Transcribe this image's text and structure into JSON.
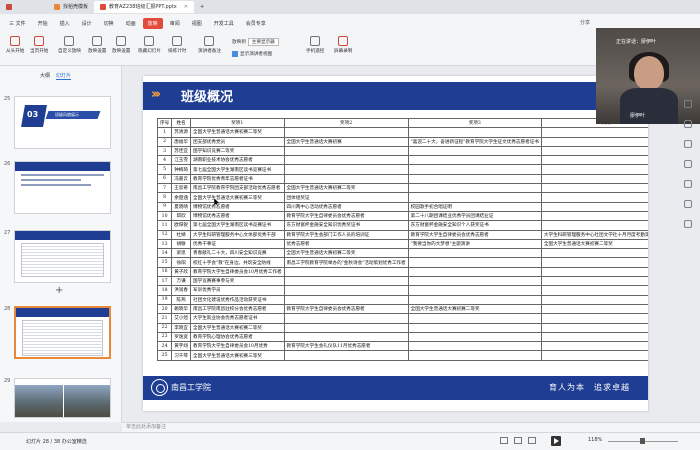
{
  "tabs": [
    {
      "label": "",
      "active": false
    },
    {
      "label": "找稻壳模板",
      "active": false
    },
    {
      "label": "教育AZ238班级汇报PPT.pptx",
      "active": true
    }
  ],
  "menu": [
    "三 文件",
    "开始",
    "插入",
    "设计",
    "切换",
    "动画",
    "放映",
    "审阅",
    "视图",
    "开发工具",
    "会员专享"
  ],
  "menu_active_index": 6,
  "share_label": "分享",
  "ribbon": {
    "buttons": [
      "从头开始",
      "当页开始",
      "自定义放映",
      "放映设置",
      "放映设置",
      "隐藏幻灯片",
      "排练计时",
      "演讲者备注",
      "手机遥控",
      "屏幕录制"
    ],
    "monitor_label": "放映到",
    "monitor_value": "主要显示器",
    "show_toolbar_label": "显示演讲者视图"
  },
  "left_panel": {
    "tabs": [
      "大纲",
      "幻灯片"
    ],
    "thumb_numbers": [
      "25",
      "26",
      "27",
      "28",
      "29"
    ],
    "section_thumb_text": "班级风貌展示",
    "section_thumb_number": "03"
  },
  "slide": {
    "title": "班级概况",
    "table_headers": [
      "序号",
      "姓名",
      "奖项1",
      "奖项2",
      "奖项3",
      "奖项4",
      "奖项5"
    ],
    "rows": [
      [
        "1",
        "苏清源",
        "全国大学生普通话大赛初赛二等奖",
        "",
        "",
        "",
        ""
      ],
      [
        "2",
        "唐福华",
        "团支部优秀党员",
        "全国大学生普通话大赛初赛",
        "\"喜迎二十大，奋进新征程\"教育学院大学生征文优秀志愿者证书",
        "",
        ""
      ],
      [
        "3",
        "苏佳宜",
        "国学知识竞赛二等奖",
        "",
        "",
        "",
        ""
      ],
      [
        "4",
        "江玉雪",
        "湖南职业技术协会优秀志愿者",
        "",
        "",
        "",
        ""
      ],
      [
        "5",
        "钟梅琦",
        "第七届全国大学生湖南区读书竞赛证书",
        "",
        "",
        "",
        ""
      ],
      [
        "6",
        "冯嘉云",
        "教育学院优秀青年志愿者证书",
        "",
        "",
        "",
        ""
      ],
      [
        "7",
        "王思奇",
        "南昌工学院教育学院团支部活动优秀志愿者",
        "全国大学生普通话大赛初赛二等奖",
        "",
        "",
        ""
      ],
      [
        "8",
        "余楚涵",
        "全国大学生普通话大赛初赛三等奖",
        "团体组奖证",
        "",
        "",
        ""
      ],
      [
        "9",
        "夏晓晴",
        "博物馆优秀志愿者",
        "四川两中心活动优秀志愿者",
        "校园歌手初合唱证明",
        "",
        ""
      ],
      [
        "10",
        "邱欣",
        "博物馆优秀志愿者",
        "教育学院大学生自律委员会优秀志愿者",
        "第二十八期团课结业优秀学员团课结业证",
        "",
        ""
      ],
      [
        "11",
        "欧阳锐",
        "第七届全国大学生湖南区读书竞赛证书",
        "东方财富杯金融安全知识优秀奖证书",
        "东方财富杯金融安全知识个人获奖证书",
        "",
        ""
      ],
      [
        "12",
        "杜婧",
        "大学生科研管理服务中心文体部优秀干部",
        "教育学院大学生会部门工作人员的培训证",
        "教育学院大学生自律委员会优秀志愿者",
        "大学生科研管理服务中心社团文学社十月月度考勤第一获得证书",
        ""
      ],
      [
        "13",
        "胡敏",
        "优秀干事证",
        "优秀志愿者",
        "\"我要当你的大梦想\"主题演讲",
        "全国大学生普通话大赛初赛二等奖",
        "军训优秀学员"
      ],
      [
        "14",
        "梁思",
        "青春献礼二十大，四川安全知识竞赛",
        "全国大学生普通话大赛初赛二等奖",
        "",
        "",
        ""
      ],
      [
        "15",
        "徐阳",
        "校红十字会\"救\"在身边，共筑安全防线",
        "南昌工学院教育学院举办的\"金秋诗会\"活动策划优秀工作者",
        "",
        "",
        ""
      ],
      [
        "16",
        "黄子欣",
        "教育学院大学生自律委员会10月优秀工作者",
        "",
        "",
        "",
        ""
      ],
      [
        "17",
        "万谦",
        "国学竞赛赛事参与奖",
        "",
        "",
        "",
        ""
      ],
      [
        "18",
        "洪润春",
        "军训优秀学员",
        "",
        "",
        "",
        ""
      ],
      [
        "19",
        "陈燕",
        "社团文化建设优秀作品活动获奖证书",
        "",
        "",
        "",
        ""
      ],
      [
        "20",
        "赖晓华",
        "南昌工学院南昌驻校分会优秀志愿者",
        "教育学院大学生自律委员会优秀志愿者",
        "全国大学生普通话大赛初赛二等奖",
        "",
        ""
      ],
      [
        "21",
        "艾小煊",
        "大学生就业协会优秀志愿者证书",
        "",
        "",
        "",
        ""
      ],
      [
        "22",
        "李晓宜",
        "全国大学生普通话大赛初赛二等奖",
        "",
        "",
        "",
        ""
      ],
      [
        "23",
        "罗逸宽",
        "教育学院心理协会优秀志愿者",
        "",
        "",
        "",
        ""
      ],
      [
        "24",
        "黄宇翊",
        "教育学院大学生自律委员会10月优秀",
        "教育学院大学生会礼仪队11月优秀志愿者",
        "",
        "",
        ""
      ],
      [
        "25",
        "习千琴",
        "全国大学生普通话大赛初赛三等奖",
        "",
        "",
        "",
        ""
      ]
    ],
    "school_name": "南昌工学院",
    "motto": "育人为本　追求卓越"
  },
  "video": {
    "caption": "正在讲话：廖伊叶",
    "name": "廖伊叶"
  },
  "notes_placeholder": "单击此处添加备注",
  "status": {
    "text": "幻灯片 28 / 38   办公室精选",
    "zoom": "118%"
  },
  "colors": {
    "slide_blue": "#1f3e93",
    "accent_orange": "#f3a23b",
    "menu_active": "#e24b3c"
  }
}
